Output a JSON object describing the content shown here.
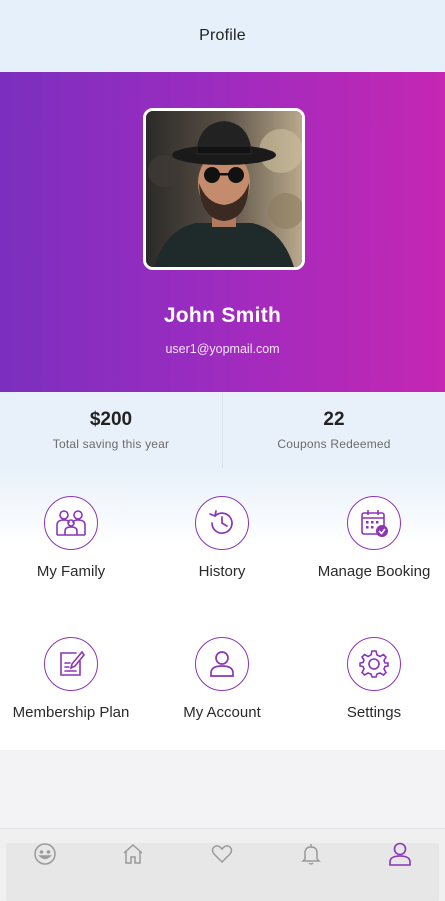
{
  "header": {
    "title": "Profile"
  },
  "profile": {
    "name": "John Smith",
    "email": "user1@yopmail.com"
  },
  "stats": [
    {
      "value": "$200",
      "label": "Total saving this year"
    },
    {
      "value": "22",
      "label": "Coupons Redeemed"
    }
  ],
  "menu": [
    {
      "label": "My Family",
      "icon": "family-icon"
    },
    {
      "label": "History",
      "icon": "history-icon"
    },
    {
      "label": "Manage Booking",
      "icon": "calendar-check-icon"
    },
    {
      "label": "Membership Plan",
      "icon": "edit-document-icon"
    },
    {
      "label": "My Account",
      "icon": "user-icon"
    },
    {
      "label": "Settings",
      "icon": "gear-icon"
    }
  ],
  "tabbar": {
    "tabs": [
      {
        "icon": "smiley-icon",
        "active": false
      },
      {
        "icon": "home-icon",
        "active": false
      },
      {
        "icon": "heart-icon",
        "active": false
      },
      {
        "icon": "bell-icon",
        "active": false
      },
      {
        "icon": "user-icon",
        "active": true
      }
    ]
  },
  "colors": {
    "accent": "#8a35b8",
    "gradient_start": "#7b2fbe",
    "gradient_end": "#c626b3",
    "inactive_icon": "#9a9a9a"
  }
}
